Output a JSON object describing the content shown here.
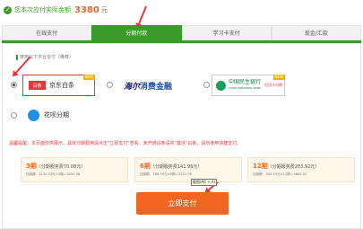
{
  "amount": {
    "prefix": "您本次应付实际金额",
    "value": "3380",
    "unit": "元"
  },
  "tabs": [
    {
      "label": "在线支付",
      "active": false
    },
    {
      "label": "分期付款",
      "active": true
    },
    {
      "label": "学习卡支付",
      "active": false
    },
    {
      "label": "现金/汇款",
      "active": false
    }
  ],
  "platform_hint": "使用以下平台支付（推荐）",
  "providers": {
    "jd": {
      "logo": "白条",
      "name": "京东白条",
      "badge": "NEW",
      "selected": true
    },
    "haier": {
      "brand": "海尔",
      "name": "消费金融"
    },
    "minsheng": {
      "name": "中国民生银行",
      "sub": "CHINA MINSHENG BANK",
      "tag": "信用卡分期",
      "badge": "NEW"
    },
    "huabei": {
      "name": "花呗分期"
    }
  },
  "warning": "温馨提醒：本页面仅供展示，具体分期费用请点击\"立即支付\"查看。未开通白条请先\"激活\"白条，请勿使用快捷支付。",
  "periods": [
    {
      "count": "3期",
      "fee": "（分期服务费70.08元）",
      "detail": "还款额：1150.33元×3期＝3450.98"
    },
    {
      "count": "6期",
      "fee": "（分期服务费141.96元）",
      "detail": "还款额：586.99元×6期＝3521.96"
    },
    {
      "count": "12期",
      "fee": "（分期服务费283.92元）",
      "detail": "还款额：305.33元×12期＝3663.92"
    }
  ],
  "tooltip": "截图(Alt + A)",
  "pay_button": "立即支付",
  "colors": {
    "brand_green": "#3a9b2a",
    "accent_orange": "#f26522",
    "alert_red": "#e4393c"
  }
}
